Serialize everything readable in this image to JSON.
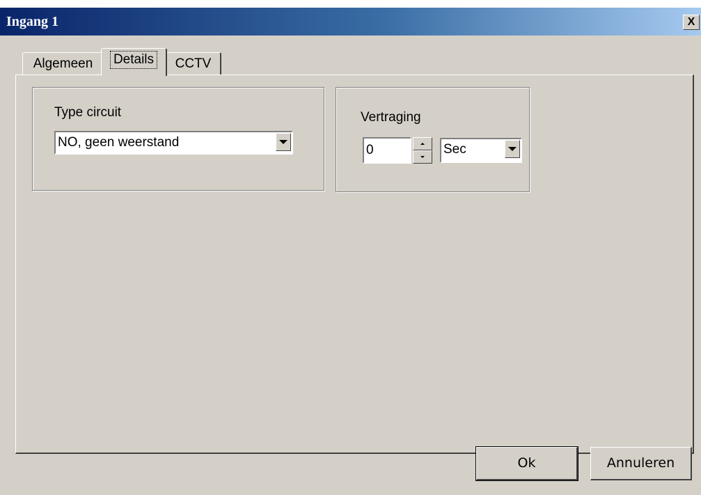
{
  "window": {
    "title": "Ingang 1",
    "close_label": "X"
  },
  "tabs": [
    {
      "label": "Algemeen",
      "active": false
    },
    {
      "label": "Details",
      "active": true
    },
    {
      "label": "CCTV",
      "active": false
    }
  ],
  "circuit_group": {
    "label": "Type circuit",
    "value": "NO, geen weerstand"
  },
  "delay_group": {
    "label": "Vertraging",
    "value": "0",
    "unit": "Sec"
  },
  "buttons": {
    "ok": "Ok",
    "cancel": "Annuleren"
  },
  "colors": {
    "face": "#d4d0c8",
    "title_start": "#0a246a",
    "title_end": "#a6caf0"
  }
}
